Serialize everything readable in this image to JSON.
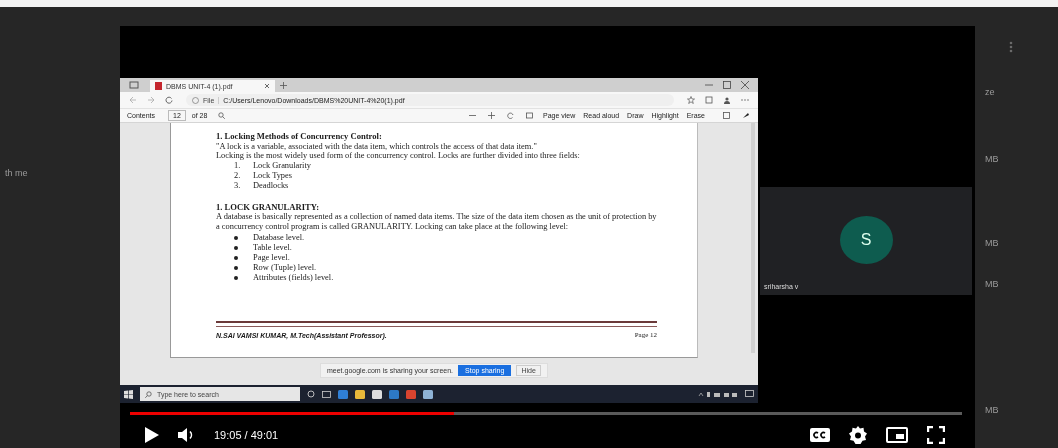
{
  "page_side": {
    "left_texts": [
      "th me"
    ],
    "right_texts": [
      "ze",
      "MB",
      "MB",
      "MB",
      "MB"
    ]
  },
  "recording": {
    "browser": {
      "tab_title": "DBMS UNIT-4 (1).pdf",
      "address_label": "File",
      "address": "C:/Users/Lenovo/Downloads/DBMS%20UNIT-4%20(1).pdf",
      "pdf_toolbar": {
        "contents": "Contents",
        "page_field": "12",
        "page_total": "of 28",
        "tools": [
          "Page view",
          "Read aloud",
          "Draw",
          "Highlight",
          "Erase"
        ]
      }
    },
    "document": {
      "blocks": [
        {
          "kind": "heading",
          "text": "1. Locking Methods of Concurrency Control:"
        },
        {
          "kind": "paragraph",
          "text": "\"A lock is a variable, associated with the data item, which controls the access of that data item.\""
        },
        {
          "kind": "paragraph",
          "text": "Locking is the most widely used form of the concurrency control. Locks are further divided into three fields:"
        },
        {
          "kind": "numbered",
          "items": [
            {
              "marker": "1.",
              "text": "Lock Granularity"
            },
            {
              "marker": "2.",
              "text": "Lock Types"
            },
            {
              "marker": "3.",
              "text": "Deadlocks"
            }
          ]
        },
        {
          "kind": "heading",
          "text": "1. LOCK GRANULARITY:"
        },
        {
          "kind": "paragraph",
          "text": "A database is basically represented as a collection of named data items.  The size of the data item chosen as the unit of protection by a concurrency control program is called GRANULARITY.  Locking can take place at the following level:"
        },
        {
          "kind": "bullets",
          "items": [
            {
              "text": "Database level."
            },
            {
              "text": "Table level."
            },
            {
              "text": "Page level."
            },
            {
              "text": "Row (Tuple) level."
            },
            {
              "text": "Attributes (fields) level."
            }
          ]
        }
      ],
      "footer_author": "N.SAI VAMSI KUMAR, M.Tech(Assistant Professor).",
      "footer_page": "Page 12"
    },
    "share_bar": {
      "message": "meet.google.com is sharing your screen.",
      "stop": "Stop sharing",
      "hide": "Hide"
    },
    "taskbar": {
      "search_placeholder": "Type here to search"
    }
  },
  "meet": {
    "participant": {
      "initial": "S",
      "name": "sriharsha v"
    }
  },
  "player": {
    "paused": true,
    "progress": {
      "level": 0.39
    },
    "time": "19:05 / 49:01"
  }
}
